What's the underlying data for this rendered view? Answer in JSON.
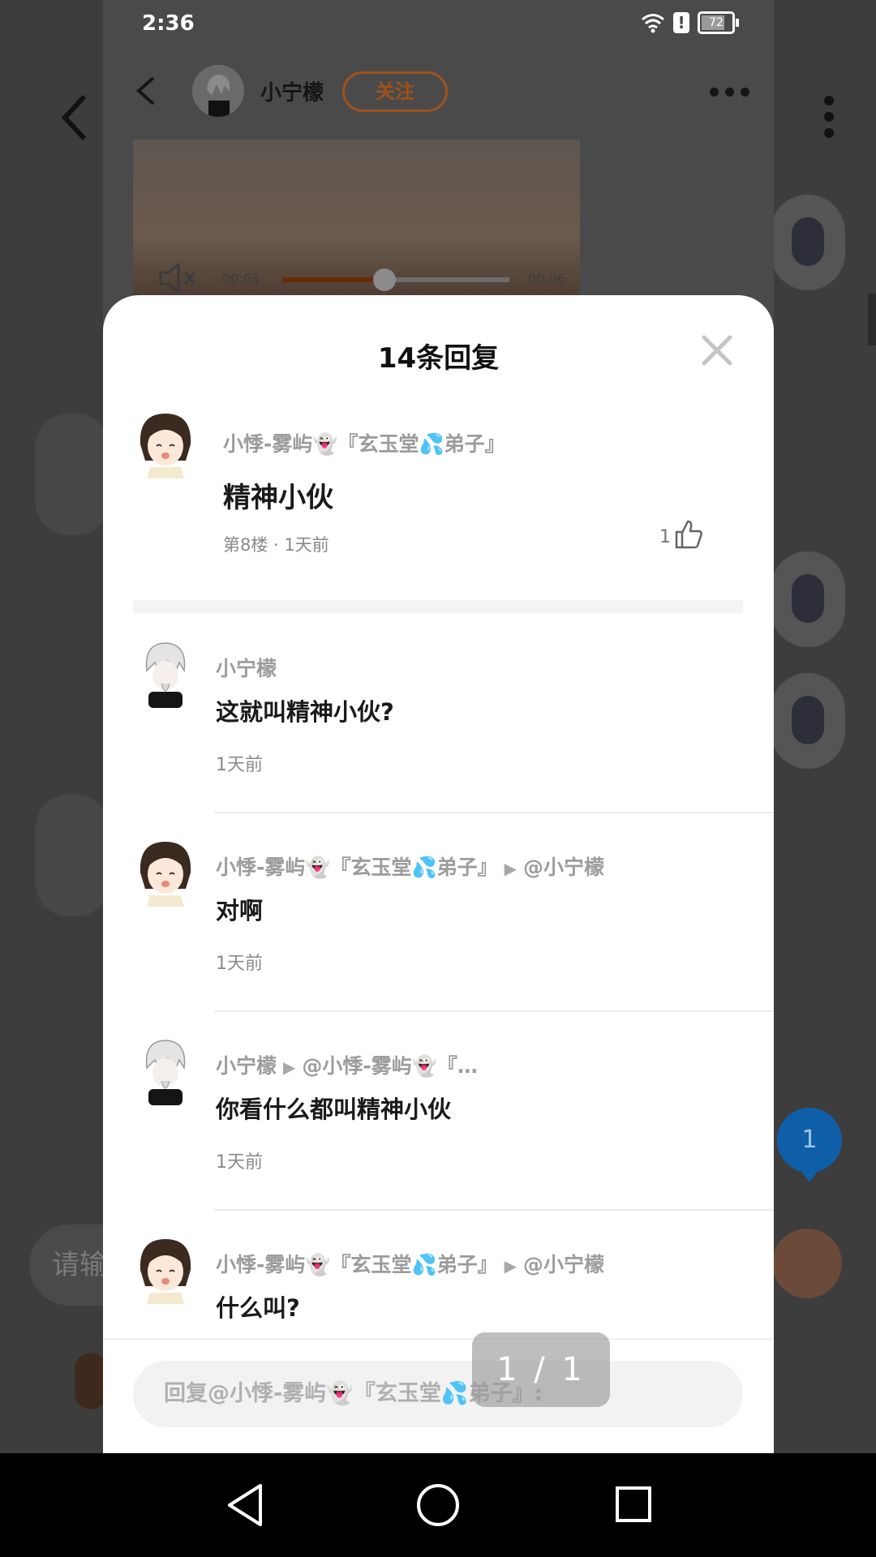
{
  "status": {
    "time": "2:36",
    "battery": "72"
  },
  "header": {
    "username": "小宁檬",
    "follow_label": "关注"
  },
  "video": {
    "current_time": "00:03",
    "duration": "00:06",
    "progress": 0.45
  },
  "sheet": {
    "title": "14条回复",
    "main_comment": {
      "nickname": "小悸-雾屿👻『玄玉堂💦弟子』",
      "text": "精神小伙",
      "meta": "第8楼 · 1天前",
      "likes": "1"
    },
    "replies": [
      {
        "nickname": "小宁檬",
        "reply_to": "",
        "text": "这就叫精神小伙?",
        "time": "1天前",
        "avatar": "boy"
      },
      {
        "nickname": "小悸-雾屿👻『玄玉堂💦弟子』",
        "reply_to": "@小宁檬",
        "text": "对啊",
        "time": "1天前",
        "avatar": "girl"
      },
      {
        "nickname": "小宁檬",
        "reply_to": "@小悸-雾屿👻『…",
        "text": "你看什么都叫精神小伙",
        "time": "1天前",
        "avatar": "boy"
      },
      {
        "nickname": "小悸-雾屿👻『玄玉堂💦弟子』",
        "reply_to": "@小宁檬",
        "text": "什么叫?",
        "time": "",
        "avatar": "girl"
      }
    ],
    "reply_placeholder": "回复@小悸-雾屿👻『玄玉堂💦弟子』:"
  },
  "pager": "1 / 1",
  "background": {
    "badge": "1",
    "input_placeholder": "请输"
  },
  "colors": {
    "accent": "#a0521c",
    "badge": "#0f5fa8"
  },
  "nav": {
    "icons": [
      "back-triangle-icon",
      "home-circle-icon",
      "recents-square-icon"
    ]
  }
}
